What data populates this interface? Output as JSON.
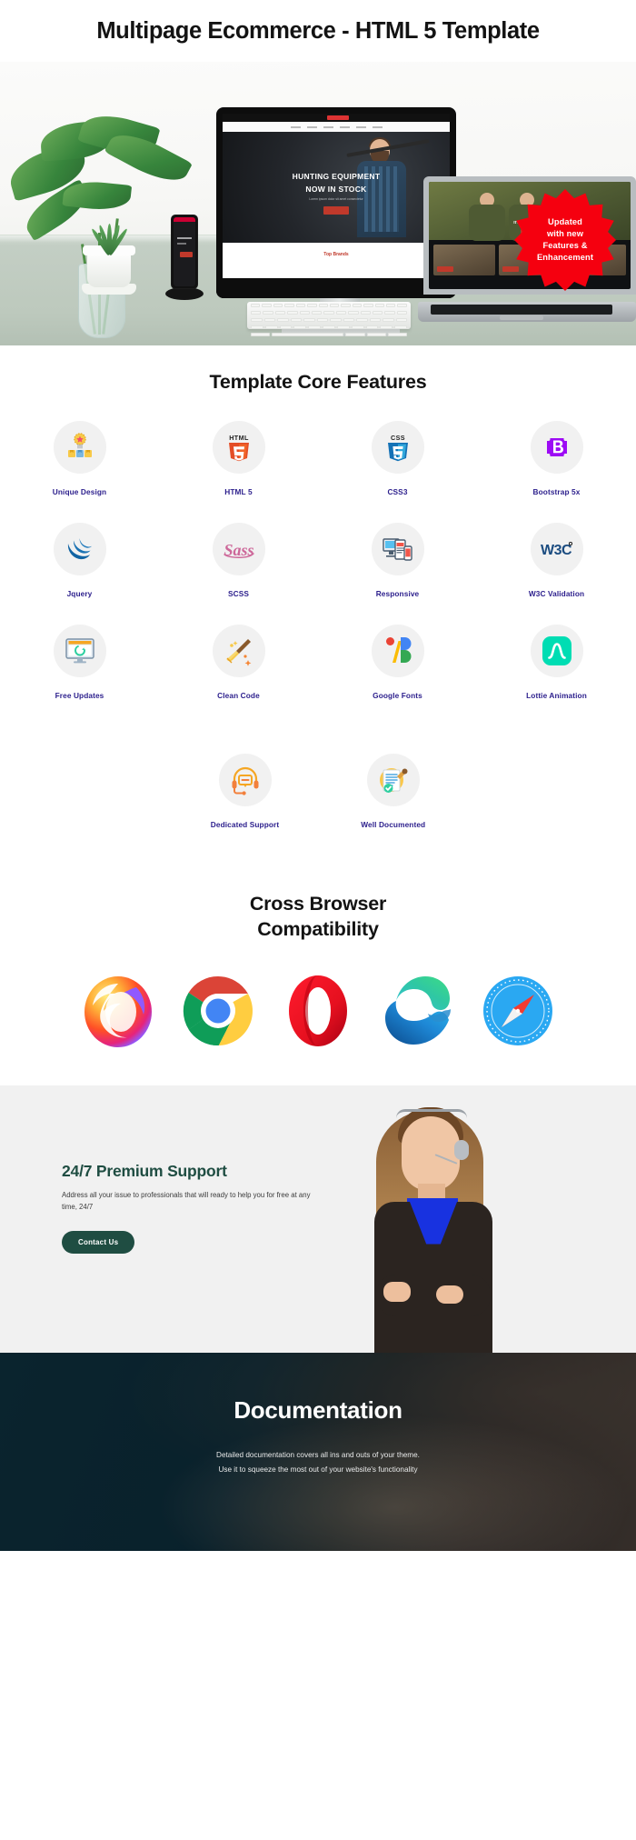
{
  "header": {
    "title": "Multipage Ecommerce - HTML 5 Template"
  },
  "hero": {
    "badge_lines": [
      "Updated",
      "with new",
      "Features &",
      "Enhancement"
    ],
    "preview_headline_1": "HUNTING EQUIPMENT",
    "preview_headline_2": "NOW IN STOCK",
    "preview_subtext": "Lorem ipsum dolor sit amet consectetur",
    "preview_cta": "Read more",
    "preview_brands": "Top Brands",
    "laptop_headline": "It's Your Season"
  },
  "features": {
    "title": "Template Core Features",
    "items": [
      {
        "label": "Unique Design",
        "icon": "award-badge-icon"
      },
      {
        "label": "HTML 5",
        "icon": "html5-icon"
      },
      {
        "label": "CSS3",
        "icon": "css3-icon"
      },
      {
        "label": "Bootstrap 5x",
        "icon": "bootstrap-icon"
      },
      {
        "label": "Jquery",
        "icon": "jquery-icon"
      },
      {
        "label": "SCSS",
        "icon": "sass-icon"
      },
      {
        "label": "Responsive",
        "icon": "responsive-devices-icon"
      },
      {
        "label": "W3C Validation",
        "icon": "w3c-icon"
      },
      {
        "label": "Free Updates",
        "icon": "monitor-refresh-icon"
      },
      {
        "label": "Clean Code",
        "icon": "broom-icon"
      },
      {
        "label": "Google Fonts",
        "icon": "google-fonts-icon"
      },
      {
        "label": "Lottie Animation",
        "icon": "lottie-icon"
      },
      {
        "label": "Dedicated Support",
        "icon": "headset-icon"
      },
      {
        "label": "Well Documented",
        "icon": "document-check-icon"
      }
    ],
    "label_color": "#2b1e8c",
    "circle_bg": "#f1f1f1",
    "icon_text": {
      "html5": "HTML",
      "html5_num": "5",
      "css3": "CSS",
      "css3_num": "3",
      "bootstrap": "B",
      "w3c": "W3C",
      "sass": "Sass"
    }
  },
  "browsers": {
    "title_line_1": "Cross Browser",
    "title_line_2": "Compatibility",
    "items": [
      {
        "name": "firefox-logo"
      },
      {
        "name": "chrome-logo"
      },
      {
        "name": "opera-logo"
      },
      {
        "name": "edge-logo"
      },
      {
        "name": "safari-logo"
      }
    ]
  },
  "support": {
    "heading": "24/7 Premium Support",
    "body": "Address all your issue to professionals that will ready to help you for free at any time, 24/7",
    "button_label": "Contact Us",
    "bg_color": "#f1f1f1",
    "accent_color": "#1f4d42"
  },
  "documentation": {
    "heading": "Documentation",
    "line_1": "Detailed documentation covers all ins and outs of your theme.",
    "line_2": "Use it to squeeze the most out of your website's functionality"
  }
}
